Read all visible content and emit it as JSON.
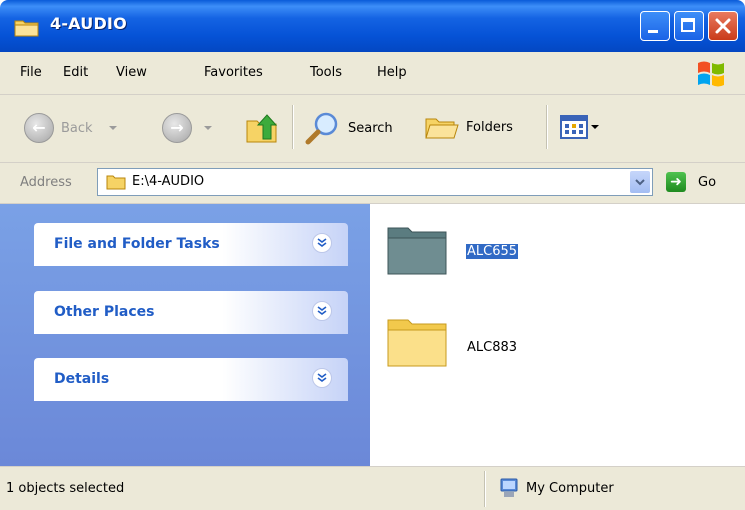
{
  "window": {
    "title": "4-AUDIO"
  },
  "menubar": {
    "items": [
      {
        "label": "File"
      },
      {
        "label": "Edit"
      },
      {
        "label": "View"
      },
      {
        "label": "Favorites"
      },
      {
        "label": "Tools"
      },
      {
        "label": "Help"
      }
    ]
  },
  "toolbar": {
    "back_label": "Back",
    "search_label": "Search",
    "folders_label": "Folders"
  },
  "address": {
    "label": "Address",
    "value": "E:\\4-AUDIO",
    "go_label": "Go"
  },
  "tasks": {
    "panels": [
      {
        "title": "File and Folder Tasks"
      },
      {
        "title": "Other Places"
      },
      {
        "title": "Details"
      }
    ]
  },
  "files": [
    {
      "name": "ALC655",
      "selected": true
    },
    {
      "name": "ALC883",
      "selected": false
    }
  ],
  "status": {
    "left": "1 objects selected",
    "right": "My Computer"
  },
  "colors": {
    "titlebar": "#0552d6",
    "task_pane": "#7aa1e6",
    "task_title": "#215dc6",
    "selection": "#316ac5",
    "chrome": "#ece9d8"
  }
}
